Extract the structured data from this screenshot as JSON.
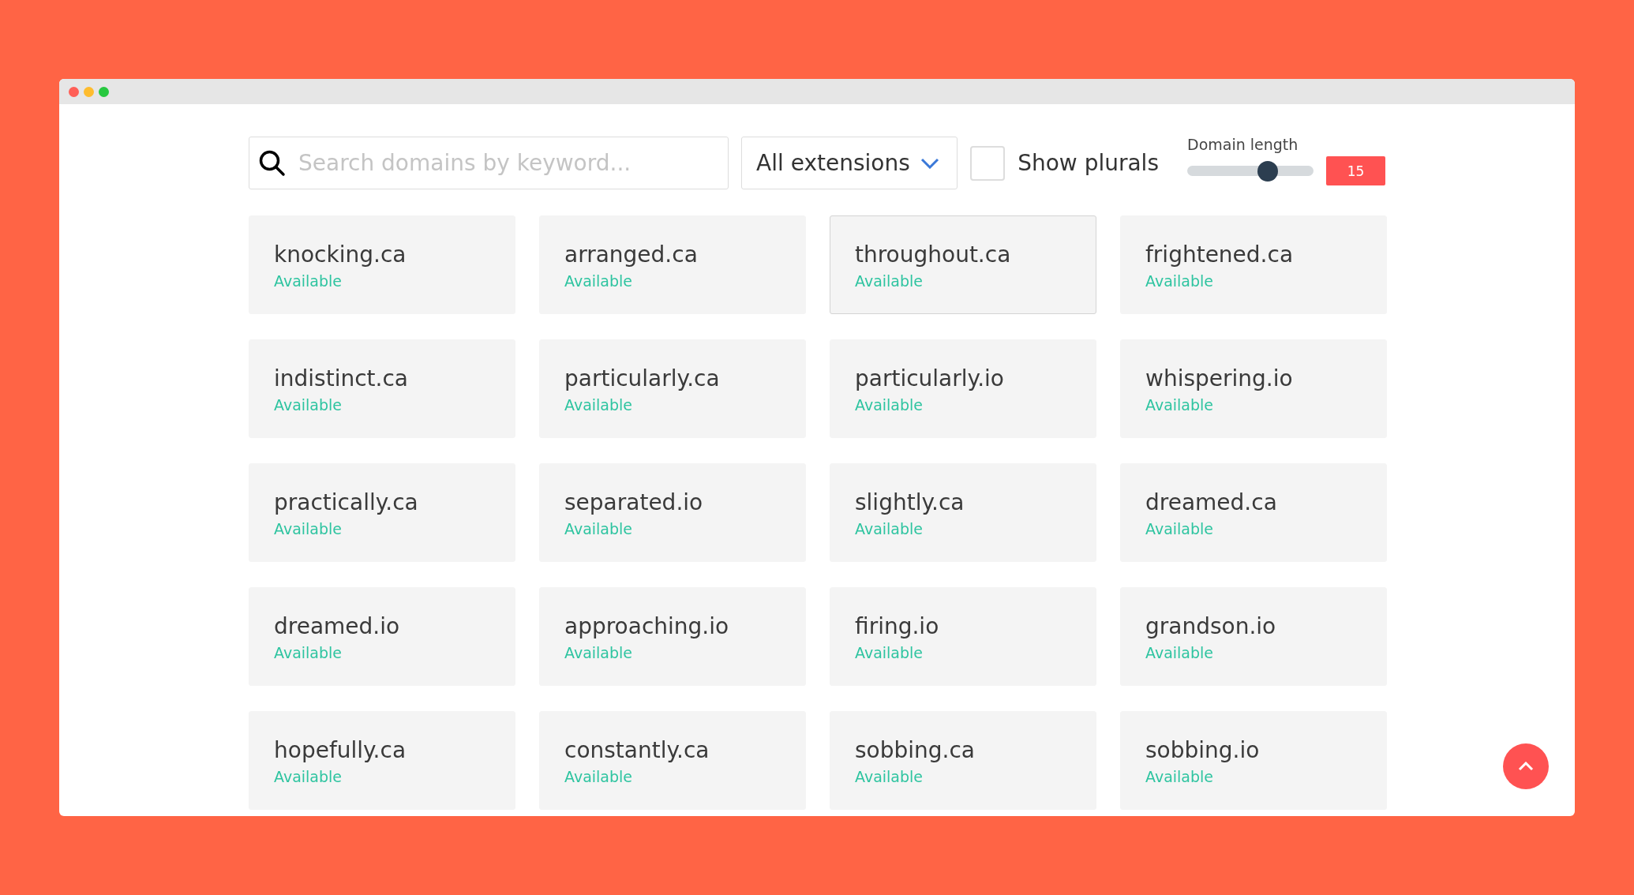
{
  "search": {
    "placeholder": "Search domains by keyword..."
  },
  "extension_dropdown": {
    "value": "All extensions"
  },
  "show_plurals": {
    "label": "Show plurals",
    "checked": false
  },
  "domain_length": {
    "label": "Domain length",
    "level": 0.64,
    "value": "15"
  },
  "domains": [
    {
      "name": "knocking.ca",
      "status": "Available",
      "selected": false
    },
    {
      "name": "arranged.ca",
      "status": "Available",
      "selected": false
    },
    {
      "name": "throughout.ca",
      "status": "Available",
      "selected": true
    },
    {
      "name": "frightened.ca",
      "status": "Available",
      "selected": false
    },
    {
      "name": "indistinct.ca",
      "status": "Available",
      "selected": false
    },
    {
      "name": "particularly.ca",
      "status": "Available",
      "selected": false
    },
    {
      "name": "particularly.io",
      "status": "Available",
      "selected": false
    },
    {
      "name": "whispering.io",
      "status": "Available",
      "selected": false
    },
    {
      "name": "practically.ca",
      "status": "Available",
      "selected": false
    },
    {
      "name": "separated.io",
      "status": "Available",
      "selected": false
    },
    {
      "name": "slightly.ca",
      "status": "Available",
      "selected": false
    },
    {
      "name": "dreamed.ca",
      "status": "Available",
      "selected": false
    },
    {
      "name": "dreamed.io",
      "status": "Available",
      "selected": false
    },
    {
      "name": "approaching.io",
      "status": "Available",
      "selected": false
    },
    {
      "name": "firing.io",
      "status": "Available",
      "selected": false
    },
    {
      "name": "grandson.io",
      "status": "Available",
      "selected": false
    },
    {
      "name": "hopefully.ca",
      "status": "Available",
      "selected": false
    },
    {
      "name": "constantly.ca",
      "status": "Available",
      "selected": false
    },
    {
      "name": "sobbing.ca",
      "status": "Available",
      "selected": false
    },
    {
      "name": "sobbing.io",
      "status": "Available",
      "selected": false
    }
  ]
}
